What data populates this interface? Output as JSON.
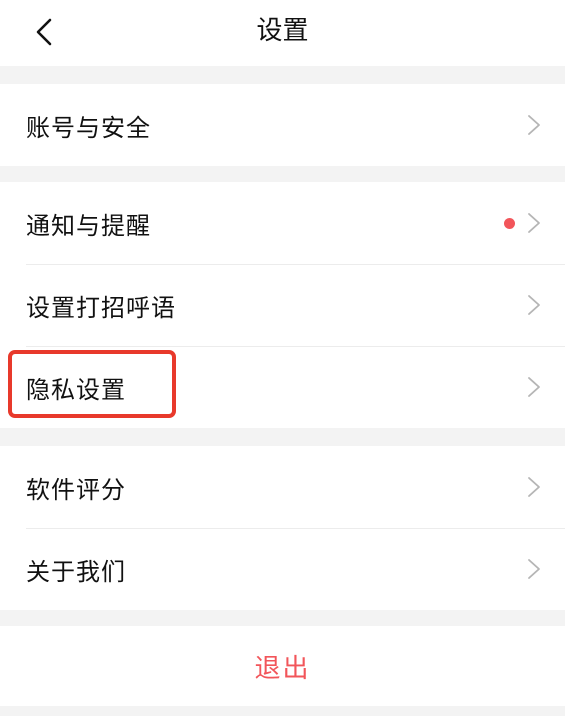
{
  "header": {
    "title": "设置",
    "back_icon": "chevron-left-icon"
  },
  "groups": [
    {
      "items": [
        {
          "label": "账号与安全",
          "icon": "chevron-right-icon"
        }
      ]
    },
    {
      "items": [
        {
          "label": "通知与提醒",
          "icon": "chevron-right-icon",
          "badge": "red-dot",
          "badge_color": "#f2555a"
        },
        {
          "label": "设置打招呼语",
          "icon": "chevron-right-icon"
        },
        {
          "label": "隐私设置",
          "icon": "chevron-right-icon",
          "highlighted": true,
          "highlight_color": "#e8392b"
        }
      ]
    },
    {
      "items": [
        {
          "label": "软件评分",
          "icon": "chevron-right-icon"
        },
        {
          "label": "关于我们",
          "icon": "chevron-right-icon"
        }
      ]
    }
  ],
  "logout": {
    "label": "退出",
    "color": "#f2555a"
  },
  "colors": {
    "background": "#f3f3f3",
    "surface": "#ffffff",
    "text": "#111111",
    "chevron": "#b5b5b5",
    "divider": "#ececec"
  }
}
